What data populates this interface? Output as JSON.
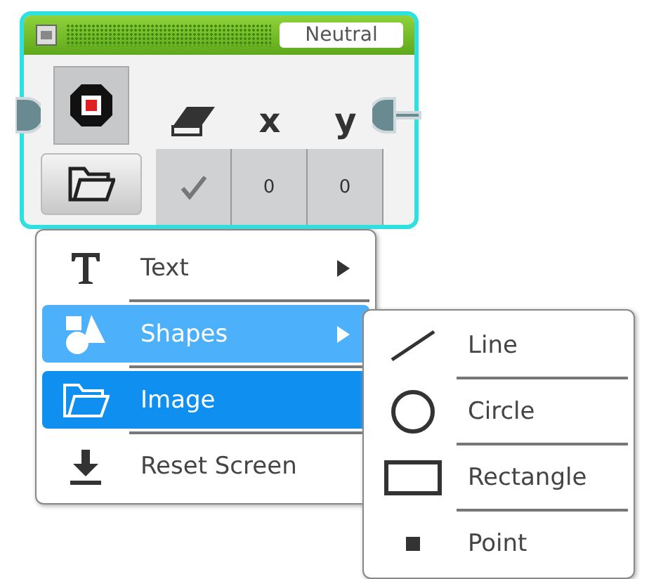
{
  "block": {
    "title": "Neutral",
    "parameters": [
      {
        "kind": "toggle",
        "checked": true
      },
      {
        "kind": "number",
        "header": "x",
        "value": "0"
      },
      {
        "kind": "number",
        "header": "y",
        "value": "0"
      }
    ]
  },
  "menu": {
    "items": [
      {
        "kind": "text",
        "label": "Text",
        "submenu": true,
        "expanded": false,
        "selected": false
      },
      {
        "kind": "shapes",
        "label": "Shapes",
        "submenu": true,
        "expanded": true,
        "selected": false
      },
      {
        "kind": "image",
        "label": "Image",
        "submenu": false,
        "expanded": false,
        "selected": true
      },
      {
        "kind": "reset",
        "label": "Reset Screen",
        "submenu": false,
        "expanded": false,
        "selected": false
      }
    ]
  },
  "submenu": {
    "items": [
      {
        "kind": "line",
        "label": "Line"
      },
      {
        "kind": "circle",
        "label": "Circle"
      },
      {
        "kind": "rectangle",
        "label": "Rectangle"
      },
      {
        "kind": "point",
        "label": "Point"
      }
    ]
  }
}
